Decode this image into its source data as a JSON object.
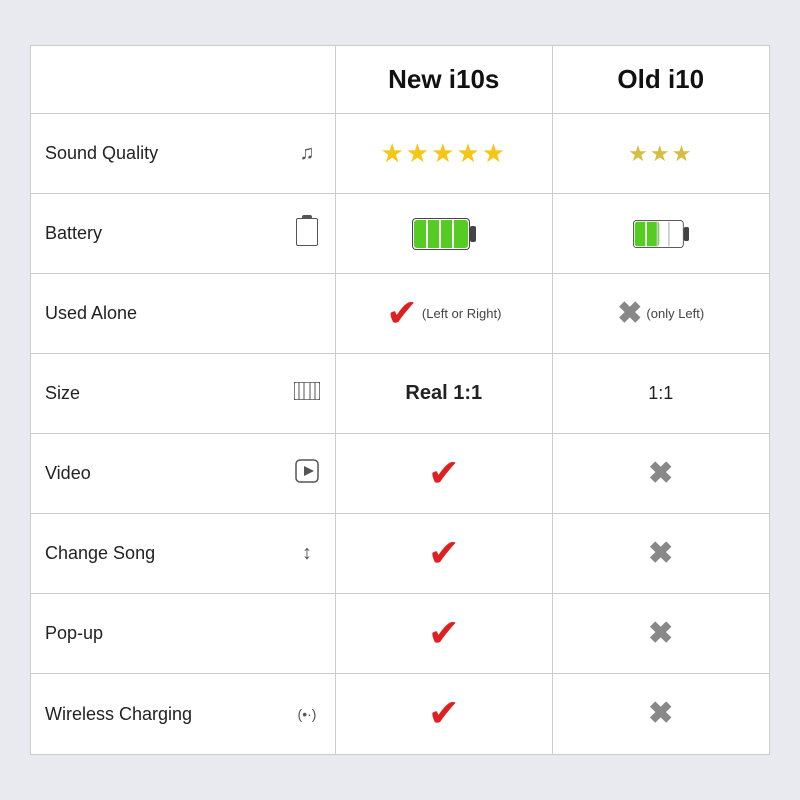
{
  "header": {
    "col1_label": "",
    "col2_label": "New i10s",
    "col3_label": "Old i10"
  },
  "rows": [
    {
      "id": "sound-quality",
      "label": "Sound Quality",
      "icon": "♫",
      "new_type": "stars5",
      "old_type": "stars3"
    },
    {
      "id": "battery",
      "label": "Battery",
      "icon": "🔋",
      "new_type": "battery-full",
      "old_type": "battery-half"
    },
    {
      "id": "used-alone",
      "label": "Used Alone",
      "icon": "",
      "new_type": "check-note",
      "new_note": "(Left or Right)",
      "old_type": "cross-note",
      "old_note": "(only Left)"
    },
    {
      "id": "size",
      "label": "Size",
      "icon": "⊟",
      "new_type": "text-bold",
      "new_text": "Real 1:1",
      "old_type": "text",
      "old_text": "1:1"
    },
    {
      "id": "video",
      "label": "Video",
      "icon": "▶",
      "new_type": "check",
      "old_type": "cross"
    },
    {
      "id": "change-song",
      "label": "Change Song",
      "icon": "↕",
      "new_type": "check",
      "old_type": "cross"
    },
    {
      "id": "pop-up",
      "label": "Pop-up",
      "icon": "",
      "new_type": "check",
      "old_type": "cross"
    },
    {
      "id": "wireless-charging",
      "label": "Wireless Charging",
      "icon": "(•·)",
      "new_type": "check",
      "old_type": "cross"
    }
  ]
}
